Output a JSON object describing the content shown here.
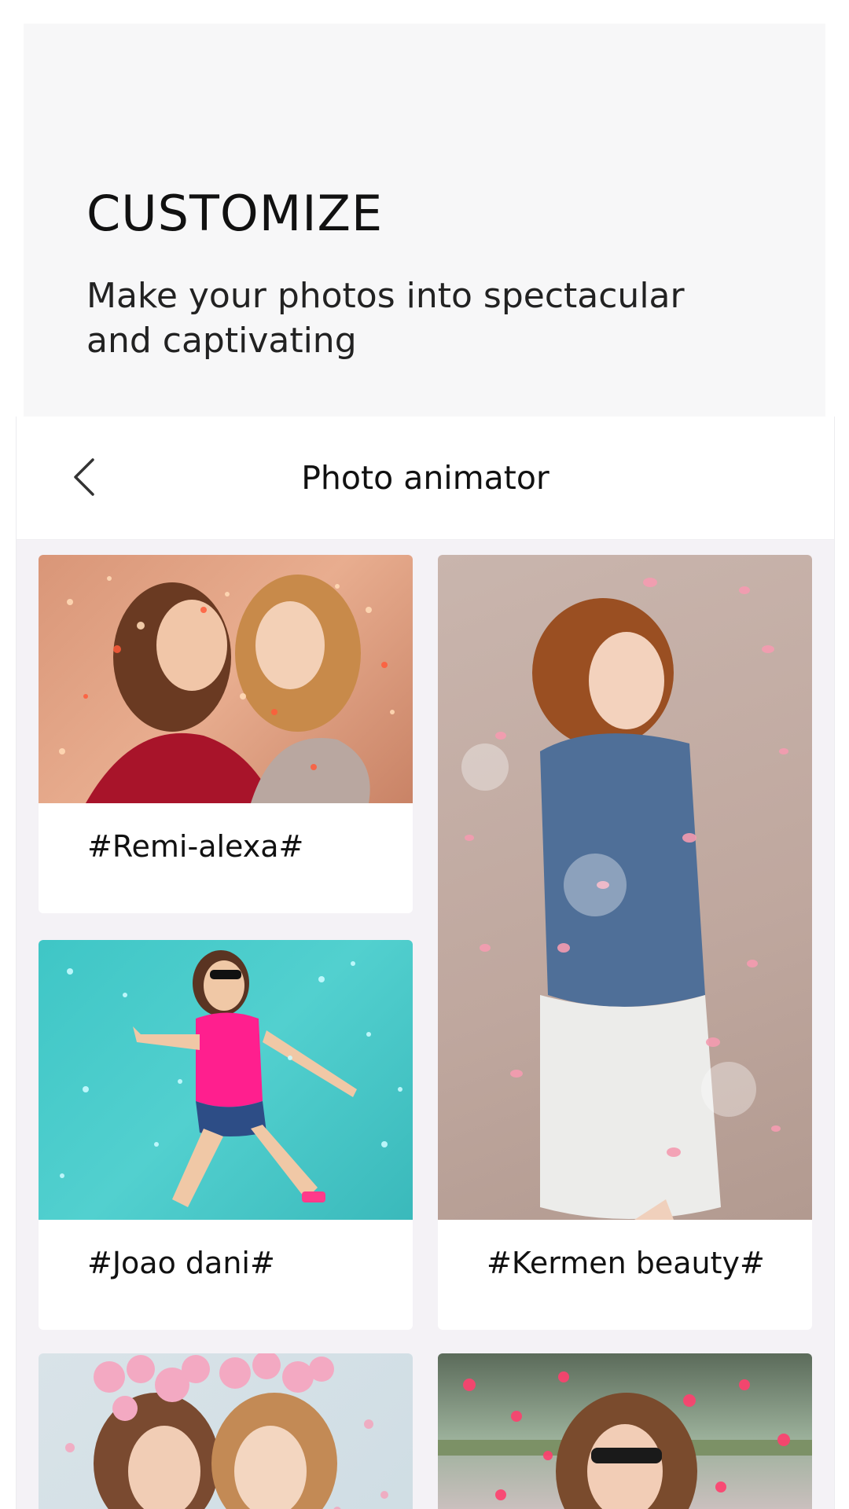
{
  "hero": {
    "title": "CUSTOMIZE",
    "subtitle": "Make your photos into spectacular and captivating"
  },
  "appbar": {
    "back_icon": "chevron-left-icon",
    "title": "Photo animator"
  },
  "cards": [
    {
      "label": "#Remi-alexa#",
      "image": "two-women-red-glitter"
    },
    {
      "label": "#Kermen beauty#",
      "image": "woman-denim-jacket-petals"
    },
    {
      "label": "#Joao dani#",
      "image": "woman-pink-top-teal-stars"
    },
    {
      "label": "",
      "image": "women-flower-crowns-hearts"
    },
    {
      "label": "",
      "image": "woman-sunglasses-red-hearts"
    }
  ],
  "colors": {
    "hero_bg": "#f7f7f8",
    "list_bg": "#f4f2f6",
    "card_bg": "#ffffff"
  }
}
